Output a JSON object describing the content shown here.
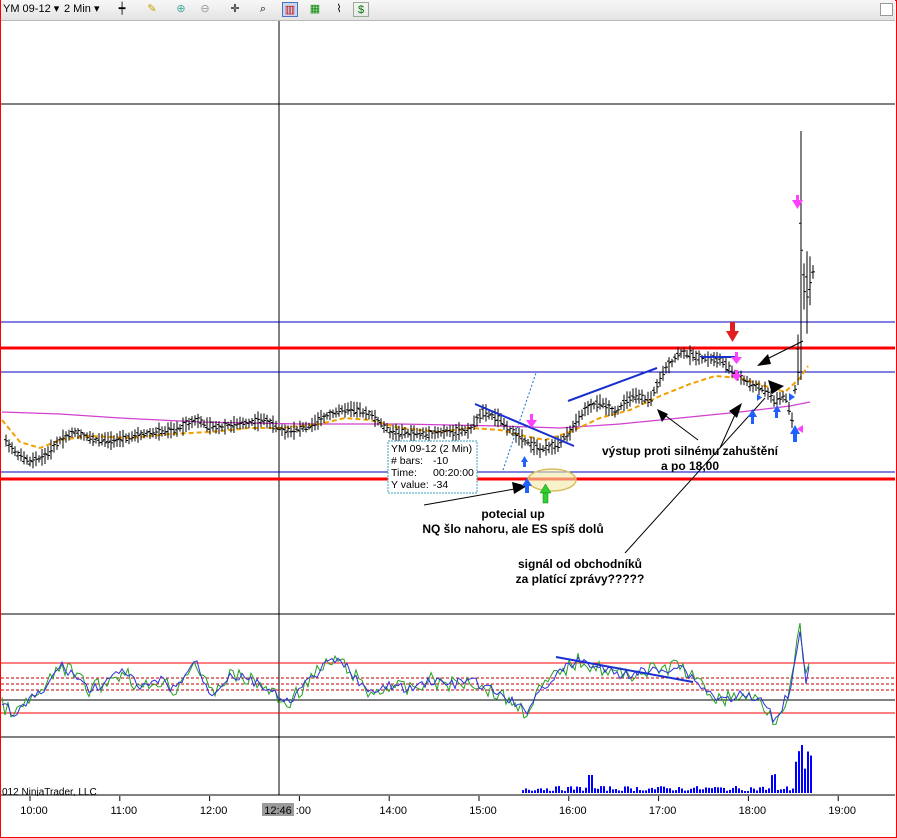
{
  "toolbar": {
    "instrument": "YM 09-12",
    "interval": "2 Min",
    "icons": [
      "bar-type-icon",
      "pencil-icon",
      "zoom-in-icon",
      "zoom-out-icon",
      "crosshair-icon",
      "magnify-icon",
      "chart-bar-icon",
      "candle-icon",
      "line-icon",
      "dollar-icon"
    ]
  },
  "chart_data": {
    "type": "bar",
    "instrument": "YM 09-12 (2 Min)",
    "x_ticks": [
      "10:00",
      "11:00",
      "12:00",
      "13:00",
      "14:00",
      "15:00",
      "16:00",
      "17:00",
      "18:00",
      "19:00"
    ],
    "cursor_time": "12:46",
    "copyright": "012 NinjaTrader, LLC",
    "data_box": {
      "title": "YM 09-12 (2 Min)",
      "bars_label": "# bars:",
      "bars": "-10",
      "time_label": "Time:",
      "time": "00:20:00",
      "y_label": "Y value:",
      "y": "-34"
    },
    "annotations": {
      "potential": "potecial up",
      "nq_es": "NQ šlo nahoru, ale ES spíš dolů",
      "signal_1": "signál od obchodníků",
      "signal_2": "za platící zprávy?????",
      "exit_1": "výstup proti silnému zahuštění",
      "exit_2": "a po 18,00"
    },
    "colors": {
      "price_bars": "#000000",
      "sma_orange": "#f0a000",
      "sma_magenta": "#d040d0",
      "support_red": "#ff0000",
      "level_blue": "#0000c0",
      "trendline": "#1a2fd0",
      "osc_blue": "#3030e0",
      "osc_green": "#20a020",
      "volume": "#0000ff",
      "arrow_pink": "#ff40ff",
      "arrow_up_blue": "#2060ff",
      "arrow_green": "#30d030",
      "arrow_red": "#e02020"
    }
  }
}
